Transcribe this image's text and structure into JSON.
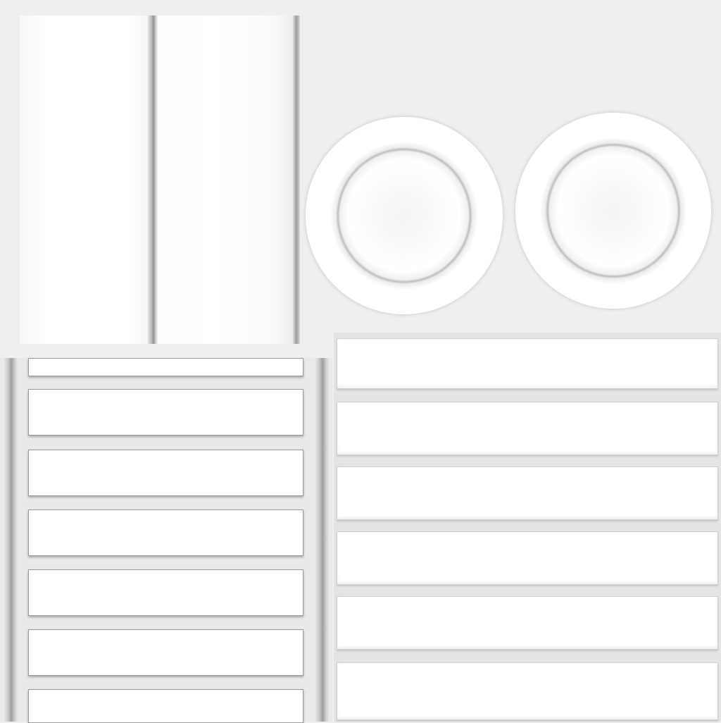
{
  "canvas": {
    "background": "#efefef",
    "panel_color": "#ffffff",
    "shadow_color": "#8f8f8f"
  },
  "shapes": {
    "tall_panels": 2,
    "rings": 2,
    "ladder_rungs": 7,
    "planks": 6
  }
}
